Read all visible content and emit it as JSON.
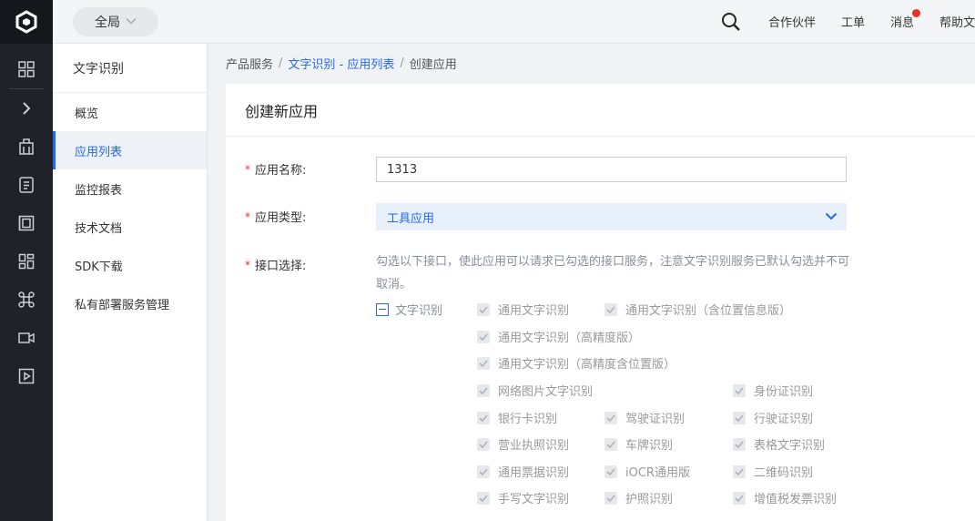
{
  "topbar": {
    "scope_label": "全局",
    "links": [
      "合作伙伴",
      "工单",
      "消息",
      "帮助文"
    ]
  },
  "sidebar": {
    "title": "文字识别",
    "items": [
      "概览",
      "应用列表",
      "监控报表",
      "技术文档",
      "SDK下载",
      "私有部署服务管理"
    ],
    "active_index": 1
  },
  "breadcrumb": {
    "root": "产品服务",
    "link": "文字识别 - 应用列表",
    "current": "创建应用",
    "separator": "/"
  },
  "form": {
    "panel_title": "创建新应用",
    "required_mark": "*",
    "name_label": "应用名称:",
    "name_value": "1313",
    "type_label": "应用类型:",
    "type_value": "工具应用",
    "api_label": "接口选择:",
    "api_hint": "勾选以下接口，使此应用可以请求已勾选的接口服务，注意文字识别服务已默认勾选并不可取消。",
    "group_label": "文字识别",
    "options": [
      "通用文字识别",
      "通用文字识别（含位置信息版）",
      "通用文字识别（高精度版）",
      "通用文字识别（高精度含位置版）",
      "网络图片文字识别",
      "身份证识别",
      "银行卡识别",
      "驾驶证识别",
      "行驶证识别",
      "营业执照识别",
      "车牌识别",
      "表格文字识别",
      "通用票据识别",
      "iOCR通用版",
      "二维码识别",
      "手写文字识别",
      "护照识别",
      "增值税发票识别"
    ]
  },
  "colors": {
    "accent": "#2468f2",
    "rail_bg": "#1f2329",
    "required": "#e5322d",
    "select_bg": "#e8f1fb"
  }
}
